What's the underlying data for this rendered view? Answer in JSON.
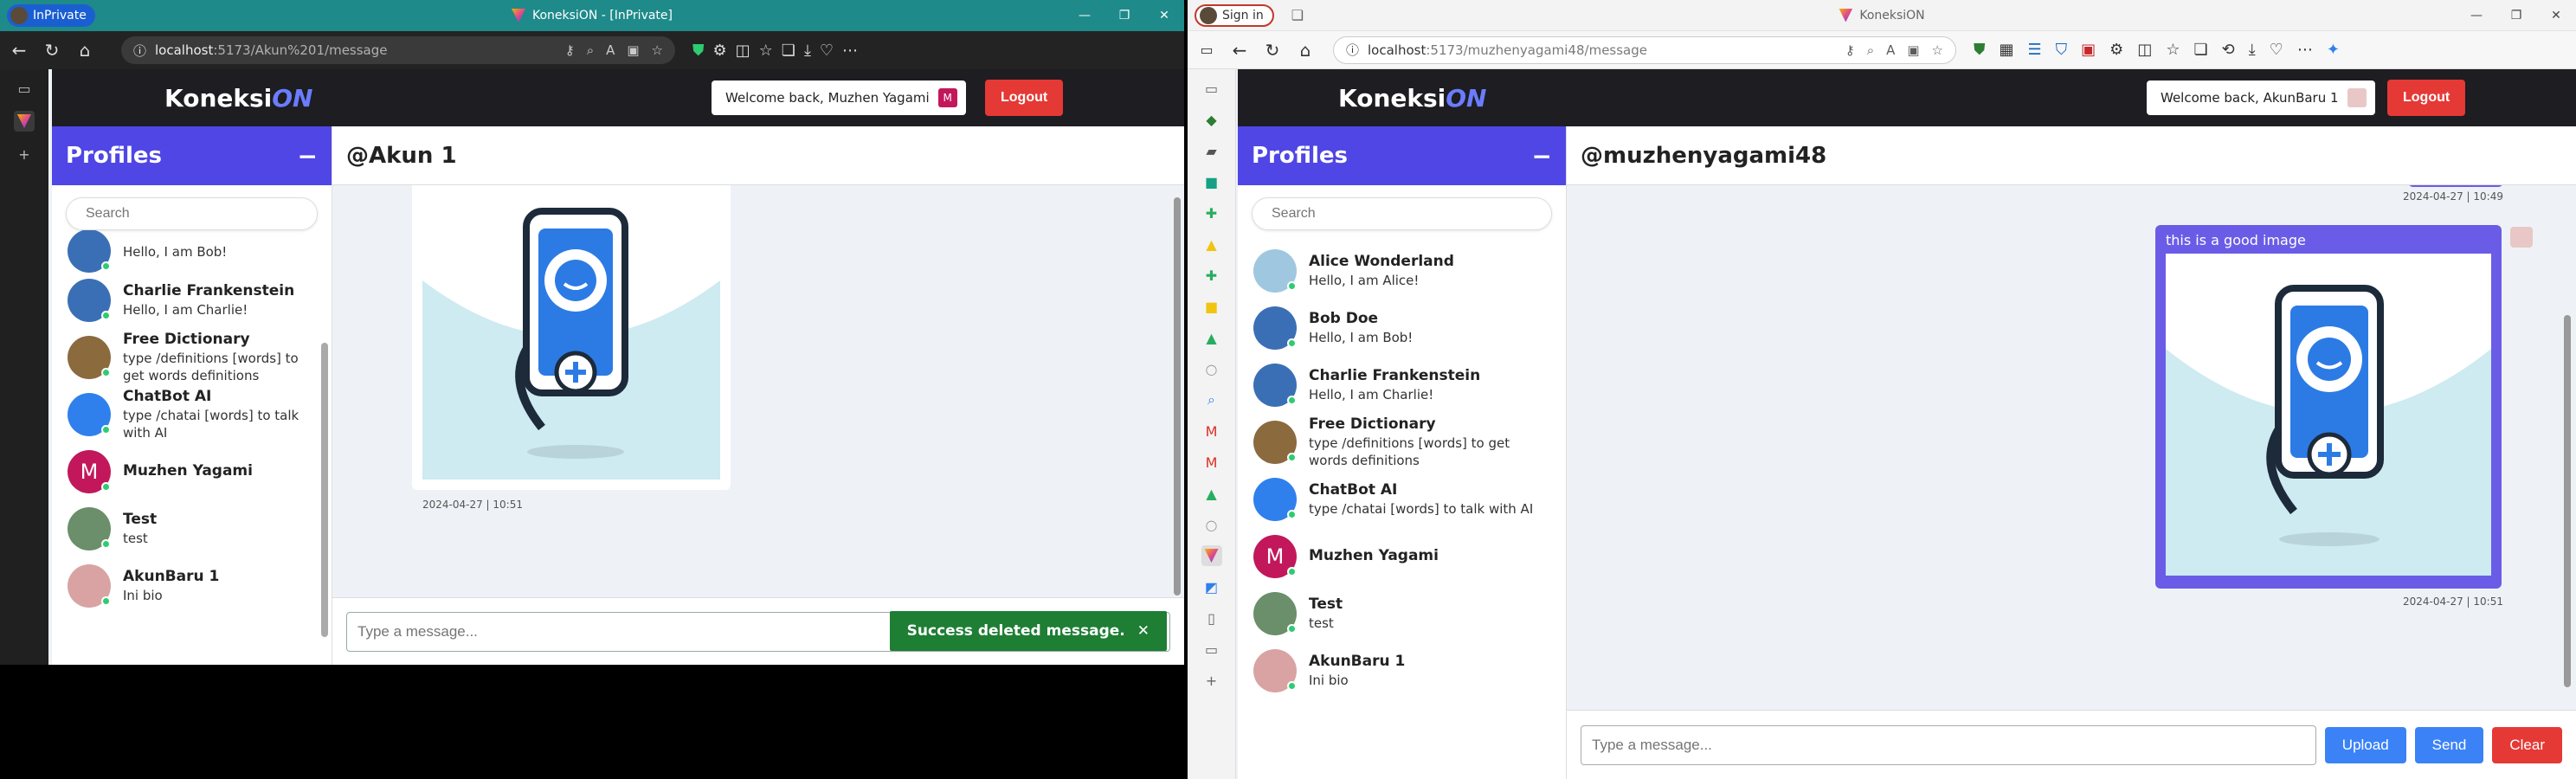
{
  "left": {
    "browser": {
      "private_label": "InPrivate",
      "title": "KoneksiON - [InPrivate]",
      "url_host": "localhost",
      "url_path": ":5173/Akun%201/message"
    },
    "app": {
      "brand_main": "Koneksi",
      "brand_accent": "ON",
      "welcome": "Welcome back, Muzhen Yagami",
      "welcome_badge": "M",
      "logout": "Logout",
      "sidebar_title": "Profiles",
      "search_placeholder": "Search",
      "profiles": [
        {
          "name": "",
          "bio": "Hello, I am Bob!"
        },
        {
          "name": "Charlie Frankenstein",
          "bio": "Hello, I am Charlie!"
        },
        {
          "name": "Free Dictionary",
          "bio": "type /definitions [words] to get words definitions"
        },
        {
          "name": "ChatBot AI",
          "bio": "type /chatai [words] to talk with AI"
        },
        {
          "name": "Muzhen Yagami",
          "bio": "",
          "initial": "M"
        },
        {
          "name": "Test",
          "bio": "test"
        },
        {
          "name": "AkunBaru 1",
          "bio": "Ini bio"
        }
      ],
      "chat_title": "@Akun 1",
      "message_time": "2024-04-27 | 10:51",
      "input_placeholder": "Type a message...",
      "toast": "Success deleted message.",
      "toast_close": "✕"
    }
  },
  "right": {
    "browser": {
      "sign_in": "Sign in",
      "title": "KoneksiON",
      "url_host": "localhost",
      "url_path": ":5173/muzhenyagami48/message"
    },
    "app": {
      "brand_main": "Koneksi",
      "brand_accent": "ON",
      "welcome": "Welcome back, AkunBaru 1",
      "logout": "Logout",
      "sidebar_title": "Profiles",
      "search_placeholder": "Search",
      "profiles": [
        {
          "name": "Alice Wonderland",
          "bio": "Hello, I am Alice!"
        },
        {
          "name": "Bob Doe",
          "bio": "Hello, I am Bob!"
        },
        {
          "name": "Charlie Frankenstein",
          "bio": "Hello, I am Charlie!"
        },
        {
          "name": "Free Dictionary",
          "bio": "type /definitions [words] to get words definitions"
        },
        {
          "name": "ChatBot AI",
          "bio": "type /chatai [words] to talk with AI"
        },
        {
          "name": "Muzhen Yagami",
          "bio": "",
          "initial": "M"
        },
        {
          "name": "Test",
          "bio": "test"
        },
        {
          "name": "AkunBaru 1",
          "bio": "Ini bio"
        }
      ],
      "chat_title": "@muzhenyagami48",
      "top_time": "2024-04-27 | 10:49",
      "message_caption": "this is a good image",
      "message_time": "2024-04-27 | 10:51",
      "input_placeholder": "Type a message...",
      "upload": "Upload",
      "send": "Send",
      "clear": "Clear"
    }
  },
  "colors": {
    "accent": "#4f46e5",
    "bubble": "#6b5ce7",
    "logout": "#e53935",
    "toast": "#1e7e34",
    "online": "#2ecc71",
    "upload": "#3b82f6"
  }
}
